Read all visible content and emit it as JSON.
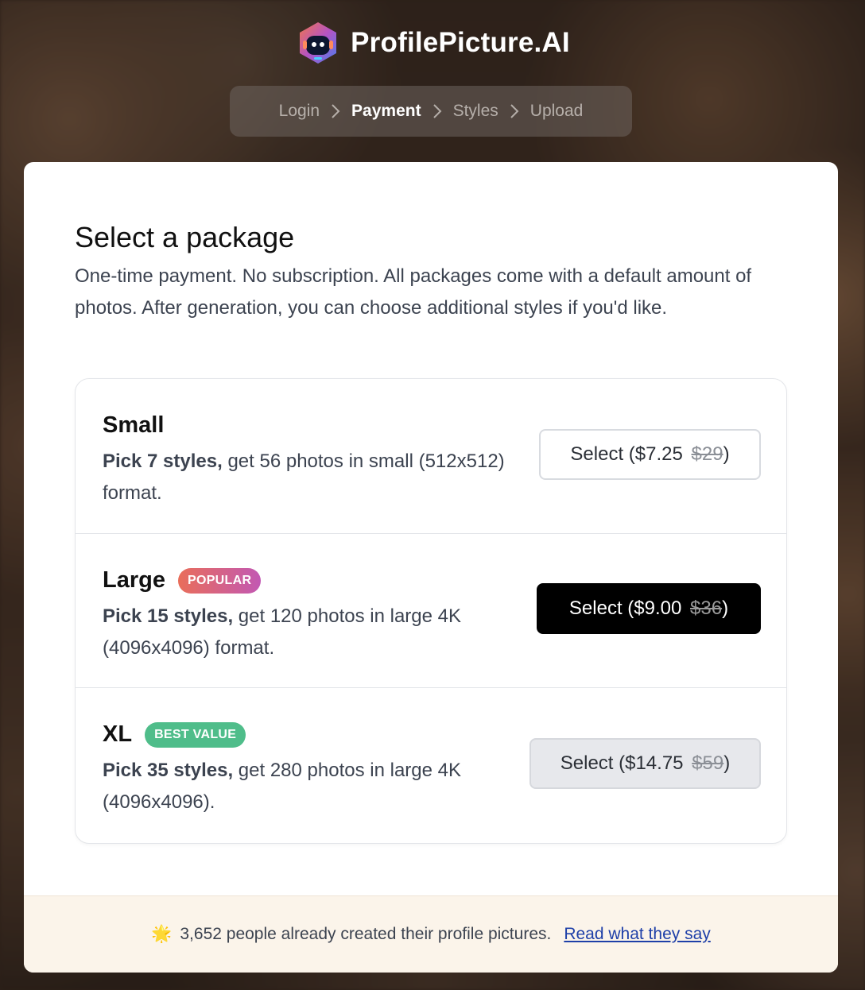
{
  "brand": {
    "name": "ProfilePicture.AI"
  },
  "steps": [
    {
      "label": "Login",
      "active": false
    },
    {
      "label": "Payment",
      "active": true
    },
    {
      "label": "Styles",
      "active": false
    },
    {
      "label": "Upload",
      "active": false
    }
  ],
  "main": {
    "title": "Select a package",
    "description": "One-time payment. No subscription. All packages come with a default amount of photos. After generation, you can choose additional styles if you'd like."
  },
  "packages": [
    {
      "name": "Small",
      "badge": "",
      "desc_bold": "Pick 7 styles,",
      "desc_rest": " get 56 photos in small (512x512) format.",
      "button_prefix": "Select ($7.25",
      "old_price": "$29",
      "button_suffix": ")"
    },
    {
      "name": "Large",
      "badge": "POPULAR",
      "desc_bold": "Pick 15 styles,",
      "desc_rest": " get 120 photos in large 4K (4096x4096) format.",
      "button_prefix": "Select ($9.00",
      "old_price": "$36",
      "button_suffix": ")"
    },
    {
      "name": "XL",
      "badge": "BEST VALUE",
      "desc_bold": "Pick 35 styles,",
      "desc_rest": " get 280 photos in large 4K (4096x4096).",
      "button_prefix": "Select ($14.75",
      "old_price": "$59",
      "button_suffix": ")"
    }
  ],
  "footer": {
    "star": "🌟",
    "text": "3,652 people already created their profile pictures.",
    "link": "Read what they say"
  },
  "colors": {
    "popular_badge": "#e96e5a",
    "best_value_badge": "#4fbd8a",
    "primary_button": "#000000",
    "footer_bg": "#fbf4ea",
    "link": "#1e3fa8"
  }
}
